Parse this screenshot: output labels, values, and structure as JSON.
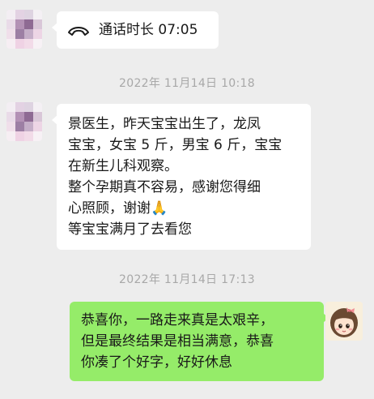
{
  "call": {
    "icon": "phone-hangup-icon",
    "label": "通话时长 07:05"
  },
  "timestamps": [
    "2022年 11月14日 10:18",
    "2022年 11月14日 17:13"
  ],
  "incoming_message": {
    "lines": [
      "景医生，昨天宝宝出生了，龙凤",
      "宝宝，女宝 5 斤，男宝 6 斤，宝宝",
      "在新生儿科观察。",
      "整个孕期真不容易，感谢您得细",
      "心照顾，谢谢",
      "等宝宝满月了去看您"
    ],
    "emoji": "🙏",
    "emoji_name": "praying-hands-icon"
  },
  "outgoing_message": {
    "lines": [
      "恭喜你，一路走来真是太艰辛，",
      "但是最终结果是相当满意，恭喜",
      "你凑了个好字，好好休息"
    ]
  },
  "colors": {
    "background": "#ededed",
    "incoming_bubble": "#ffffff",
    "outgoing_bubble": "#95ec69",
    "timestamp": "#a8a8a8"
  }
}
